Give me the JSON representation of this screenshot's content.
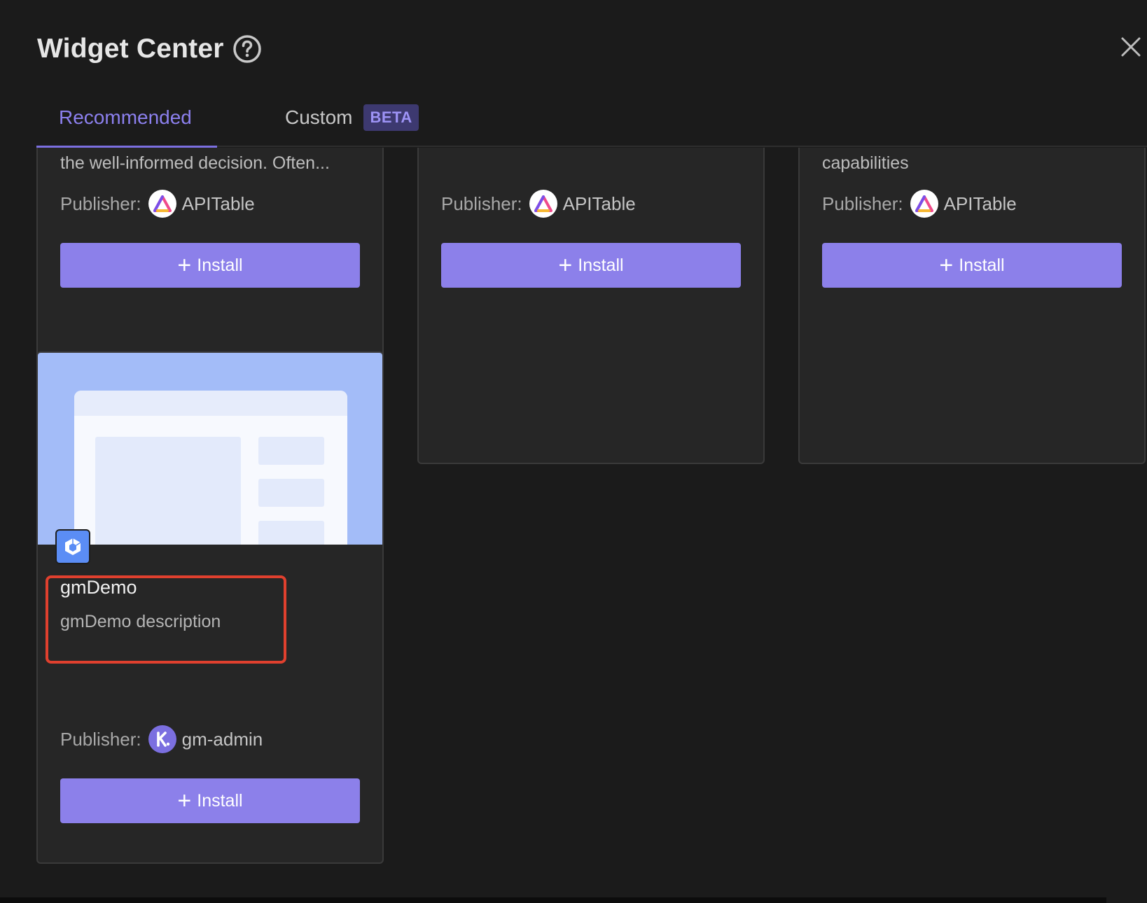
{
  "header": {
    "title": "Widget Center"
  },
  "tabs": [
    {
      "label": "Recommended",
      "active": true
    },
    {
      "label": "Custom",
      "badge": "BETA"
    }
  ],
  "colors": {
    "accent": "#8c80ea",
    "background": "#1b1b1b",
    "card": "#262626",
    "highlight": "#e0402e"
  },
  "cards_top": [
    {
      "description": "the well-informed decision. Often...",
      "publisher_label": "Publisher:",
      "publisher_name": "APITable",
      "install_label": "Install"
    },
    {
      "description": "",
      "publisher_label": "Publisher:",
      "publisher_name": "APITable",
      "install_label": "Install"
    },
    {
      "description": "capabilities",
      "publisher_label": "Publisher:",
      "publisher_name": "APITable",
      "install_label": "Install"
    }
  ],
  "demo_card": {
    "name": "gmDemo",
    "description": "gmDemo description",
    "publisher_label": "Publisher:",
    "publisher_name": "gm-admin",
    "install_label": "Install"
  },
  "icons": {
    "help": "question-circle-icon",
    "close": "close-icon",
    "plus": "plus-icon",
    "publisher_logo": "apitable-logo-icon",
    "widget": "widget-cube-icon"
  }
}
